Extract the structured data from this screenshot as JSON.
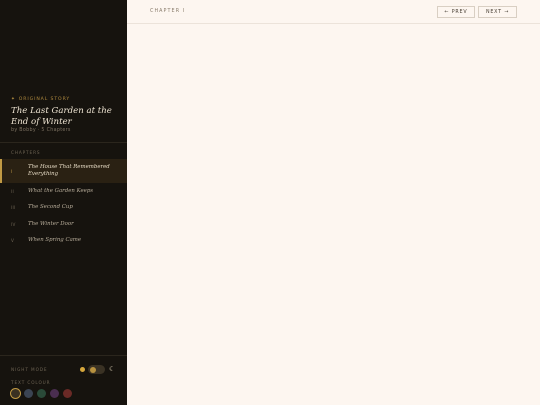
{
  "story": {
    "label": "Original Story",
    "label_icon": "star-icon",
    "title": "The Last Garden at the End of Winter",
    "meta": "by Bobby · 5 Chapters"
  },
  "chapters": {
    "label": "Chapters",
    "items": [
      {
        "num": "I",
        "name": "The House That Remembered Everything",
        "active": true
      },
      {
        "num": "II",
        "name": "What the Garden Keeps",
        "active": false
      },
      {
        "num": "III",
        "name": "The Second Cup",
        "active": false
      },
      {
        "num": "IV",
        "name": "The Winter Door",
        "active": false
      },
      {
        "num": "V",
        "name": "When Spring Came",
        "active": false
      }
    ]
  },
  "settings": {
    "night_mode_label": "Night Mode",
    "night_mode_on": false,
    "text_colour_label": "Text Colour",
    "swatches": [
      "#3a3122",
      "#3b4452",
      "#2a4a38",
      "#4a2e50",
      "#6a2a26"
    ],
    "selected_swatch": 0
  },
  "topbar": {
    "chapter_label": "Chapter I",
    "prev_label": "← PREV",
    "next_label": "NEXT →"
  },
  "colors": {
    "sidebar_bg": "#16130e",
    "accent": "#c19a44",
    "page_bg": "#fdf6f0"
  }
}
